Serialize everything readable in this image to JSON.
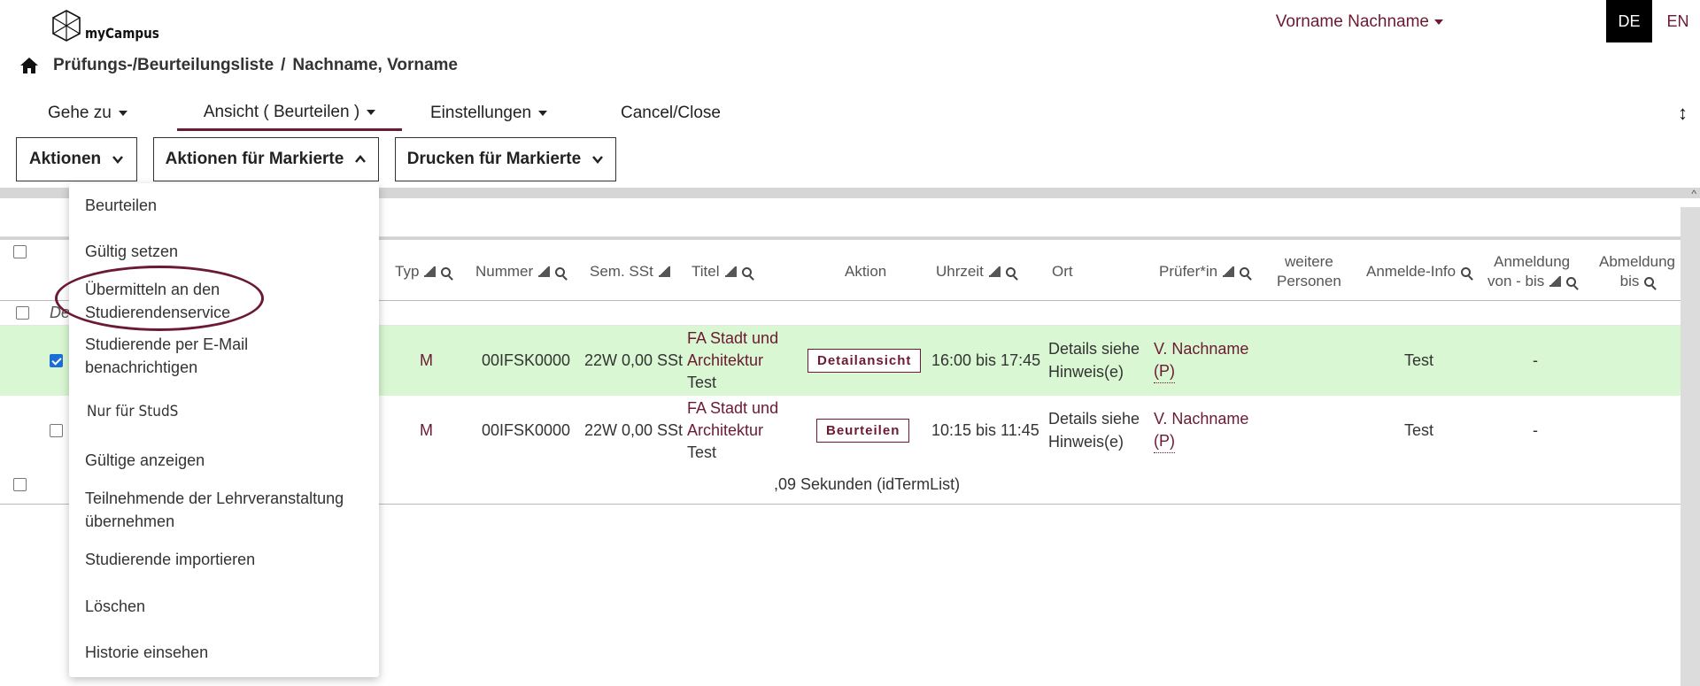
{
  "header": {
    "logo_text": "myCampus",
    "user_name": "Vorname Nachname",
    "lang_de": "DE",
    "lang_en": "EN"
  },
  "breadcrumb": {
    "page": "Prüfungs-/Beurteilungsliste",
    "separator": "/",
    "person": "Nachname, Vorname"
  },
  "menubar": {
    "goto": "Gehe zu",
    "view": "Ansicht ( Beurteilen )",
    "settings": "Einstellungen",
    "close": "Cancel/Close"
  },
  "actions": {
    "actions": "Aktionen",
    "marked": "Aktionen für Markierte",
    "print": "Drucken für Markierte"
  },
  "table": {
    "group_label": "De",
    "headers": {
      "typ": "Typ",
      "nummer": "Nummer",
      "sem": "Sem. SSt",
      "titel": "Titel",
      "aktion": "Aktion",
      "uhrzeit": "Uhrzeit",
      "ort": "Ort",
      "pruefer": "Prüfer*in",
      "weitere_1": "weitere",
      "weitere_2": "Personen",
      "anmelde_info": "Anmelde-Info",
      "anmeldung_1": "Anmeldung",
      "anmeldung_2": "von - bis",
      "abmeldung_1": "Abmeldung",
      "abmeldung_2": "bis"
    },
    "rows": [
      {
        "typ": "M",
        "nummer": "00IFSK0000",
        "sem": "22W 0,00 SSt",
        "titel_1": "FA Stadt und",
        "titel_2": "Architektur",
        "titel_3": "Test",
        "aktion": "Detailansicht",
        "uhrzeit": "16:00 bis 17:45",
        "ort_1": "Details siehe",
        "ort_2": "Hinweis(e)",
        "pruefer_1": "V. Nachname",
        "pruefer_2": "(P)",
        "anmelde_info": "Test",
        "anmeldung": "-"
      },
      {
        "typ": "M",
        "nummer": "00IFSK0000",
        "sem": "22W 0,00 SSt",
        "titel_1": "FA Stadt und",
        "titel_2": "Architektur",
        "titel_3": "Test",
        "aktion": "Beurteilen",
        "uhrzeit": "10:15 bis 11:45",
        "ort_1": "Details siehe",
        "ort_2": "Hinweis(e)",
        "pruefer_1": "V. Nachname",
        "pruefer_2": "(P)",
        "anmelde_info": "Test",
        "anmeldung": "-"
      }
    ],
    "footer": ",09 Sekunden (idTermList)"
  },
  "dropdown": {
    "items": [
      "Beurteilen",
      "Gültig setzen",
      "Übermitteln an den",
      "Studierendenservice",
      "Studierende per E-Mail",
      "benachrichtigen",
      "Nur für StudS",
      "Gültige anzeigen",
      "Teilnehmende der Lehrveranstaltung",
      "übernehmen",
      "Studierende importieren",
      "Löschen",
      "Historie einsehen"
    ]
  }
}
